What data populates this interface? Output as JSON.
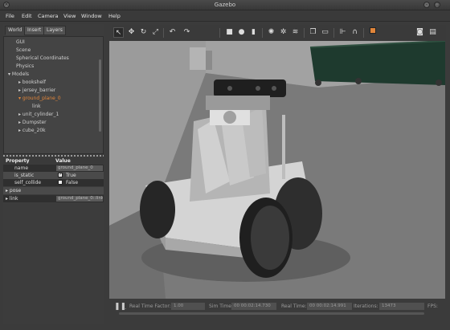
{
  "window": {
    "title": "Gazebo",
    "buttons": [
      "×",
      "-",
      "□"
    ]
  },
  "menu": [
    "File",
    "Edit",
    "Camera",
    "View",
    "Window",
    "Help"
  ],
  "left_panel": {
    "tabs": [
      "World",
      "Insert",
      "Layers"
    ],
    "tree": {
      "top_items": [
        "GUI",
        "Scene",
        "Spherical Coordinates",
        "Physics"
      ],
      "models_label": "Models",
      "models": [
        "bookshelf",
        "jersey_barrier",
        "ground_plane_0",
        "link",
        "unit_cylinder_1",
        "Dumpster",
        "cube_20k"
      ]
    },
    "properties": {
      "header": [
        "Property",
        "Value"
      ],
      "rows": [
        {
          "name": "name",
          "value": "ground_plane_0"
        },
        {
          "name": "is_static",
          "value": "True",
          "checked": true
        },
        {
          "name": "self_collide",
          "value": "False",
          "checked": false
        },
        {
          "name": "pose",
          "value": ""
        },
        {
          "name": "link",
          "value": "ground_plane_0::link"
        }
      ]
    }
  },
  "toolbar_icons": [
    "select-arrow",
    "translate",
    "rotate",
    "scale",
    "undo",
    "redo",
    "box",
    "sphere",
    "cylinder",
    "point-light",
    "spot-light",
    "directional-light",
    "copy",
    "paste",
    "align",
    "snap",
    "view-angle",
    "screenshot",
    "record"
  ],
  "status": {
    "real_time_factor_label": "Real Time Factor:",
    "real_time_factor": "1.00",
    "sim_time_label": "Sim Time:",
    "sim_time": "00 00:02:14.730",
    "real_time_label": "Real Time:",
    "real_time": "00 00:02:14.991",
    "iterations_label": "Iterations:",
    "iterations": "13473",
    "fps_label": "FPS:"
  },
  "colors": {
    "accent_orange": "#e0853a",
    "sky": "#8e8e8e",
    "floor": "#7a7a7a",
    "dumpster": "#1e3a2e"
  }
}
